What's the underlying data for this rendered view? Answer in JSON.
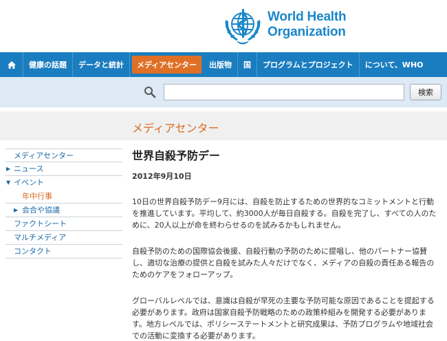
{
  "logo": {
    "line1": "World Health",
    "line2": "Organization"
  },
  "nav": {
    "home_icon": "home-icon",
    "items": [
      {
        "label": "健康の話題"
      },
      {
        "label": "データと統計"
      },
      {
        "label": "メディアセンター"
      },
      {
        "label": "出版物"
      },
      {
        "label": "国"
      },
      {
        "label": "プログラムとプロジェクト"
      },
      {
        "label": "について、WHO"
      }
    ]
  },
  "search": {
    "value": "",
    "button_label": "検索"
  },
  "section": {
    "title": "メディアセンター"
  },
  "sidebar": {
    "items": [
      {
        "label": "メディアセンター"
      },
      {
        "label": "ニュース",
        "arrow": "▶"
      },
      {
        "label": "イベント",
        "arrow": "▼"
      },
      {
        "label": "年中行事"
      },
      {
        "label": "会合や協議",
        "arrow": "▶"
      },
      {
        "label": "ファクトシート"
      },
      {
        "label": "マルチメディア"
      },
      {
        "label": "コンタクト"
      }
    ]
  },
  "article": {
    "title": "世界自殺予防デー",
    "date": "2012年9月10日",
    "paragraphs": [
      "10日の世界自殺予防デー9月には、自殺を防止するための世界的なコミットメントと行動を推進しています。平均して、約3000人が毎日自殺する。自殺を完了し、すべての人のために、20人以上が命を終わらせるのを試みるかもしれません。",
      "自殺予防のための国際協会後援、自殺行動の予防のために提唱し、他のパートナー協賛し、適切な治療の提供と自殺を試みた人々だけでなく、メディアの自殺の責任ある報告のためのケアをフォローアップ。",
      "グローバルレベルでは、意識は自殺が早死の主要な予防可能な原因であることを提起する必要があります。政府は国家自殺予防戦略のための政策枠組みを開発する必要があります。地方レベルでは、ポリシーステートメントと研究成果は、予防プログラムや地域社会での活動に変換する必要があります。"
    ]
  },
  "colors": {
    "brand_blue": "#1a87c9",
    "nav_blue": "#1a7dbf",
    "accent_orange": "#e07026"
  }
}
